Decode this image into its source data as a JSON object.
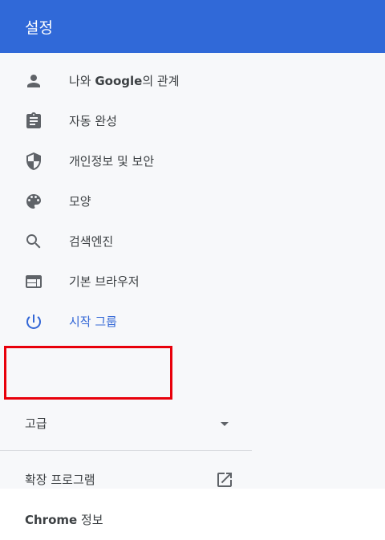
{
  "header": {
    "title": "설정"
  },
  "nav": {
    "items": [
      {
        "label_prefix": "나와 ",
        "label_bold": "Google",
        "label_suffix": "의 관계",
        "icon": "person-icon"
      },
      {
        "label": "자동 완성",
        "icon": "clipboard-icon"
      },
      {
        "label": "개인정보 및 보안",
        "icon": "shield-icon"
      },
      {
        "label": "모양",
        "icon": "palette-icon"
      },
      {
        "label": "검색엔진",
        "icon": "search-icon"
      },
      {
        "label": "기본 브라우저",
        "icon": "browser-window-icon"
      },
      {
        "label": "시작 그룹",
        "icon": "power-icon",
        "active": true
      }
    ],
    "advanced": {
      "label": "고급",
      "icon": "caret-down-icon"
    },
    "extensions": {
      "label": "확장 프로그램",
      "icon": "open-in-new-icon"
    },
    "about": {
      "label_bold": "Chrome",
      "label_suffix": " 정보"
    }
  },
  "colors": {
    "header_bg": "#3069D8",
    "active_text": "#3367d6",
    "icon_gray": "#5f6368",
    "highlight_border": "#e8000b"
  }
}
